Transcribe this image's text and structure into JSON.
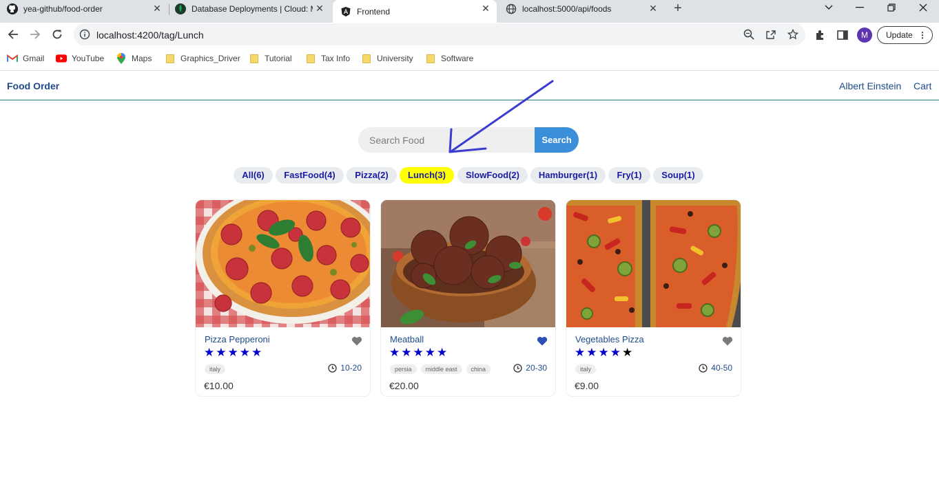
{
  "browser": {
    "tabs": [
      {
        "title": "yea-github/food-order"
      },
      {
        "title": "Database Deployments | Cloud: M"
      },
      {
        "title": "Frontend"
      },
      {
        "title": "localhost:5000/api/foods"
      }
    ],
    "url": "localhost:4200/tag/Lunch",
    "profile_initial": "M",
    "update_label": "Update",
    "bookmarks": [
      "Gmail",
      "YouTube",
      "Maps",
      "Graphics_Driver",
      "Tutorial",
      "Tax Info",
      "University",
      "Software"
    ]
  },
  "header": {
    "brand": "Food Order",
    "user": "Albert Einstein",
    "cart": "Cart"
  },
  "search": {
    "placeholder": "Search Food",
    "button": "Search"
  },
  "tags": [
    {
      "label": "All(6)",
      "active": false
    },
    {
      "label": "FastFood(4)",
      "active": false
    },
    {
      "label": "Pizza(2)",
      "active": false
    },
    {
      "label": "Lunch(3)",
      "active": true
    },
    {
      "label": "SlowFood(2)",
      "active": false
    },
    {
      "label": "Hamburger(1)",
      "active": false
    },
    {
      "label": "Fry(1)",
      "active": false
    },
    {
      "label": "Soup(1)",
      "active": false
    }
  ],
  "foods": [
    {
      "name": "Pizza Pepperoni",
      "favorite": false,
      "stars": 5,
      "origins": [
        "italy"
      ],
      "cook_time": "10-20",
      "price": "€10.00"
    },
    {
      "name": "Meatball",
      "favorite": true,
      "stars": 5,
      "origins": [
        "persia",
        "middle east",
        "china"
      ],
      "cook_time": "20-30",
      "price": "€20.00"
    },
    {
      "name": "Vegetables Pizza",
      "favorite": false,
      "stars": 4,
      "origins": [
        "italy"
      ],
      "cook_time": "40-50",
      "price": "€9.00"
    }
  ],
  "colors": {
    "accent": "#3a8fd8",
    "active_tag": "#ffff00",
    "star": "#0000cc",
    "star_empty": "#000000",
    "favorite_on": "#2a4fb5",
    "favorite_off": "#7a7a7a",
    "annotation": "#3b3bd0"
  }
}
